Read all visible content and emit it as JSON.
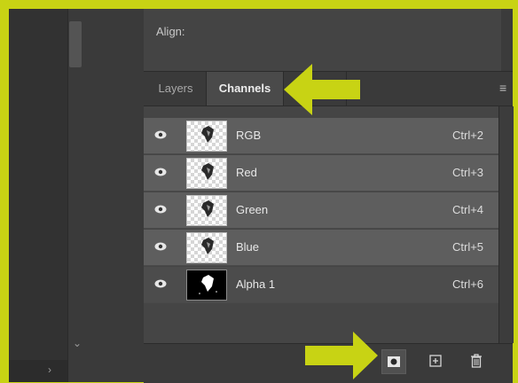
{
  "properties": {
    "align_label": "Align:"
  },
  "tabs": [
    {
      "label": "Layers",
      "active": false
    },
    {
      "label": "Channels",
      "active": true
    }
  ],
  "channels": [
    {
      "name": "RGB",
      "shortcut": "Ctrl+2",
      "visible": true,
      "thumb": "checker"
    },
    {
      "name": "Red",
      "shortcut": "Ctrl+3",
      "visible": true,
      "thumb": "checker"
    },
    {
      "name": "Green",
      "shortcut": "Ctrl+4",
      "visible": true,
      "thumb": "checker"
    },
    {
      "name": "Blue",
      "shortcut": "Ctrl+5",
      "visible": true,
      "thumb": "checker"
    },
    {
      "name": "Alpha 1",
      "shortcut": "Ctrl+6",
      "visible": true,
      "thumb": "black"
    }
  ],
  "icons": {
    "panel_menu": "panel-menu-icon",
    "visibility": "eye-icon",
    "save_selection_as_channel": "save-selection-as-channel-icon",
    "new_channel": "new-channel-icon",
    "delete_channel": "trash-icon"
  },
  "annotation_arrows": [
    {
      "target": "channels-tab",
      "direction": "left"
    },
    {
      "target": "save-selection-as-channel-button",
      "direction": "right"
    }
  ],
  "colors": {
    "highlight": "#c8d314",
    "panel_bg": "#3c3c3c",
    "row_bg": "#5e5e5e"
  }
}
